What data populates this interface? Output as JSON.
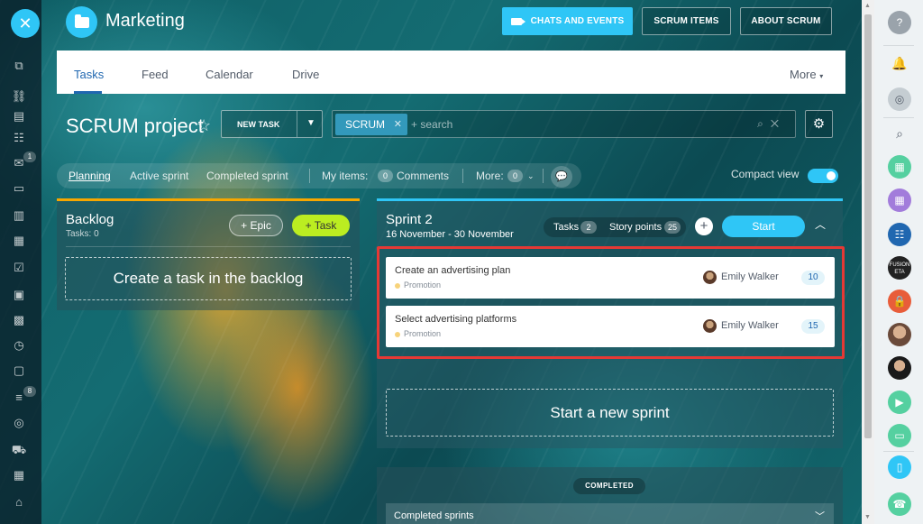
{
  "space": {
    "title": "Marketing",
    "icon": "folder-icon"
  },
  "top_buttons": {
    "chats": "CHATS AND EVENTS",
    "scrum_items": "SCRUM ITEMS",
    "about": "ABOUT SCRUM"
  },
  "tabs": [
    {
      "label": "Tasks",
      "active": true
    },
    {
      "label": "Feed"
    },
    {
      "label": "Calendar"
    },
    {
      "label": "Drive"
    }
  ],
  "tabs_more": "More",
  "project": {
    "title": "SCRUM project",
    "new_task": "NEW TASK"
  },
  "search": {
    "chip": "SCRUM",
    "placeholder": "+ search"
  },
  "filters": {
    "planning": "Planning",
    "active_sprint": "Active sprint",
    "completed_sprint": "Completed sprint",
    "my_items": "My items:",
    "comments_count": "0",
    "comments": "Comments",
    "more": "More:",
    "more_count": "0",
    "compact_view": "Compact view"
  },
  "backlog": {
    "title": "Backlog",
    "subtitle": "Tasks: 0",
    "epic_button": "Epic",
    "task_button": "Task",
    "create_placeholder": "Create a task in the backlog"
  },
  "sprint": {
    "title": "Sprint 2",
    "dates": "16 November - 30 November",
    "tasks_label": "Tasks",
    "tasks_count": "2",
    "points_label": "Story points",
    "points_count": "25",
    "start_button": "Start",
    "tasks": [
      {
        "name": "Create an advertising plan",
        "tag": "Promotion",
        "assignee": "Emily Walker",
        "points": "10"
      },
      {
        "name": "Select advertising platforms",
        "tag": "Promotion",
        "assignee": "Emily Walker",
        "points": "15"
      }
    ]
  },
  "new_sprint": "Start a new sprint",
  "completed": {
    "badge": "COMPLETED",
    "row_label": "Completed sprints"
  },
  "left_badges": {
    "messages": "1",
    "filters": "8"
  },
  "right_bar": {
    "avatar_text": "FUSION ETA"
  },
  "colors": {
    "accent": "#2fc6f6",
    "task_green": "#bbed21",
    "backlog_border": "#f7a700",
    "highlight": "#e53935"
  }
}
